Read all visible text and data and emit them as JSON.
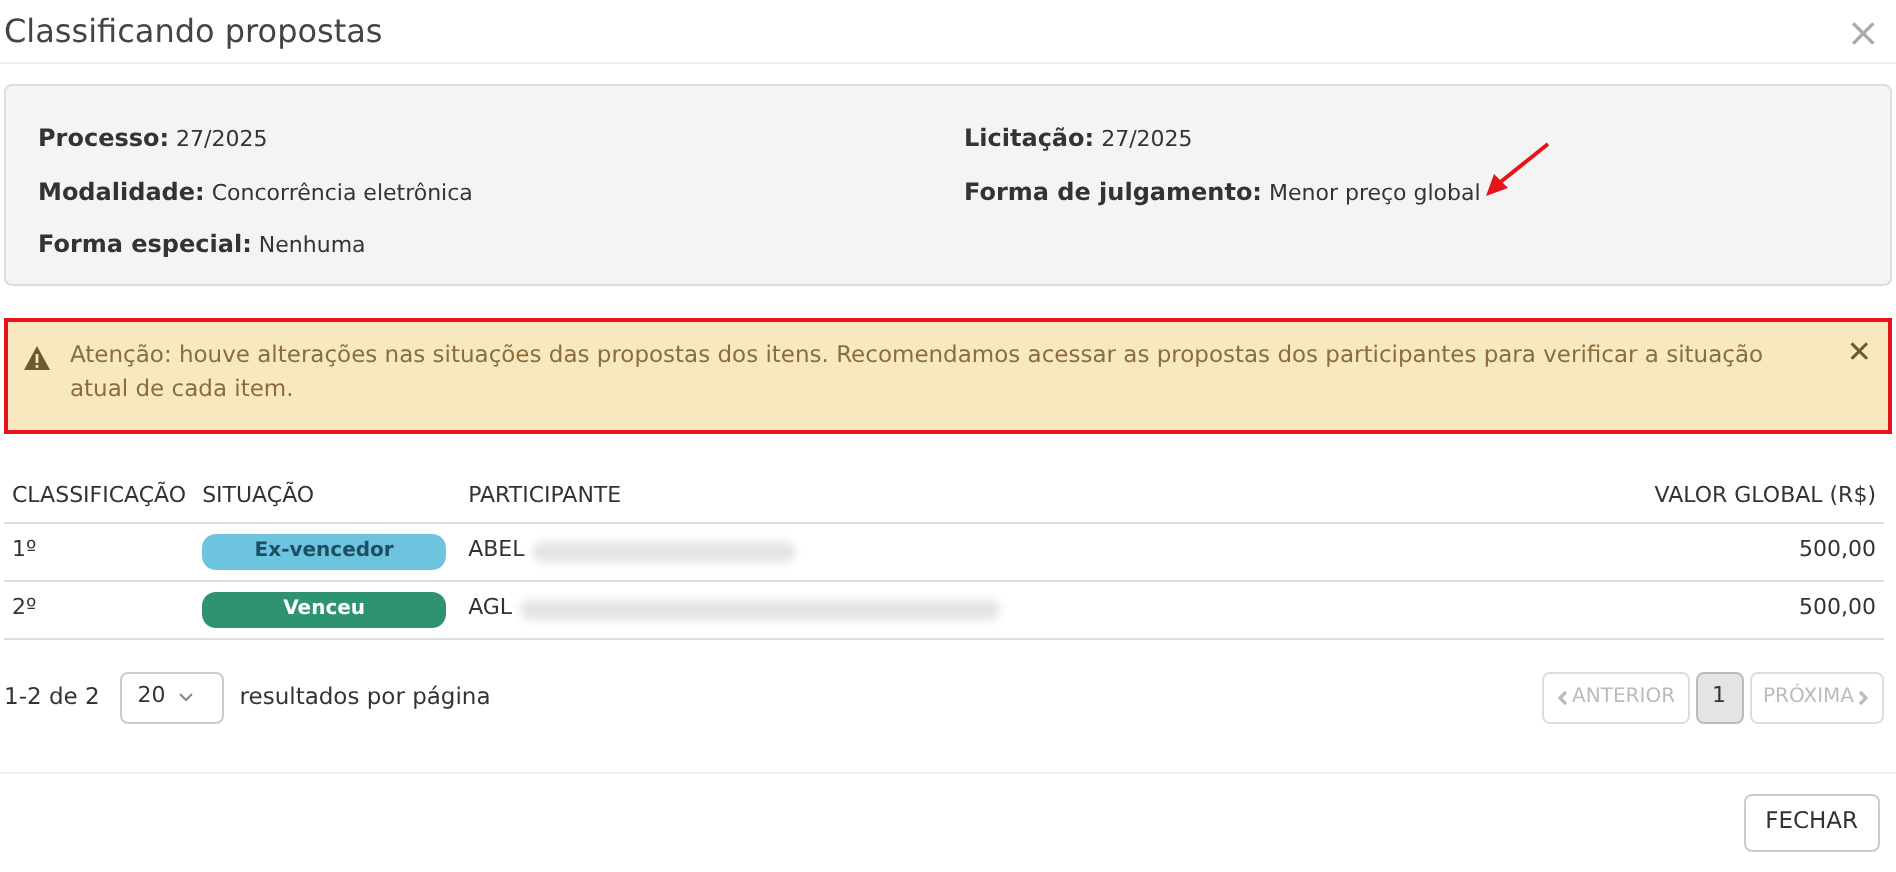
{
  "dialog": {
    "title": "Classificando propostas",
    "close": "×"
  },
  "info": [
    {
      "label": "Processo:",
      "value": "27/2025"
    },
    {
      "label": "Licitação:",
      "value": "27/2025"
    },
    {
      "label": "Modalidade:",
      "value": "Concorrência eletrônica"
    },
    {
      "label": "Forma de julgamento:",
      "value": "Menor preço global",
      "annotated": true
    },
    {
      "label": "Forma especial:",
      "value": "Nenhuma"
    }
  ],
  "alert": {
    "text": "Atenção: houve alterações nas situações das propostas dos itens. Recomendamos acessar as propostas dos participantes para verificar a situação atual de cada item.",
    "dismiss": "✕",
    "highlighted": true
  },
  "table": {
    "columns": [
      "CLASSIFICAÇÃO",
      "SITUAÇÃO",
      "PARTICIPANTE",
      "VALOR GLOBAL (R$)"
    ],
    "rows": [
      {
        "rank": "1º",
        "status": "Ex-vencedor",
        "color": "#6ec4de",
        "participant": "ABEL",
        "redacted": true,
        "value": "500,00"
      },
      {
        "rank": "2º",
        "status": "Venceu",
        "color": "#2e9470",
        "participant": "AGL",
        "redacted": true,
        "value": "500,00"
      }
    ]
  },
  "pagination": {
    "range": "1-2 de 2",
    "page_size": "20",
    "per_page_label": "resultados por página",
    "previous": {
      "label": "ANTERIOR",
      "disabled": true
    },
    "pages": [
      {
        "label": "1",
        "selected": true
      }
    ],
    "next": {
      "label": "PRÓXIMA",
      "disabled": true
    }
  },
  "buttons": [
    "FECHAR"
  ]
}
